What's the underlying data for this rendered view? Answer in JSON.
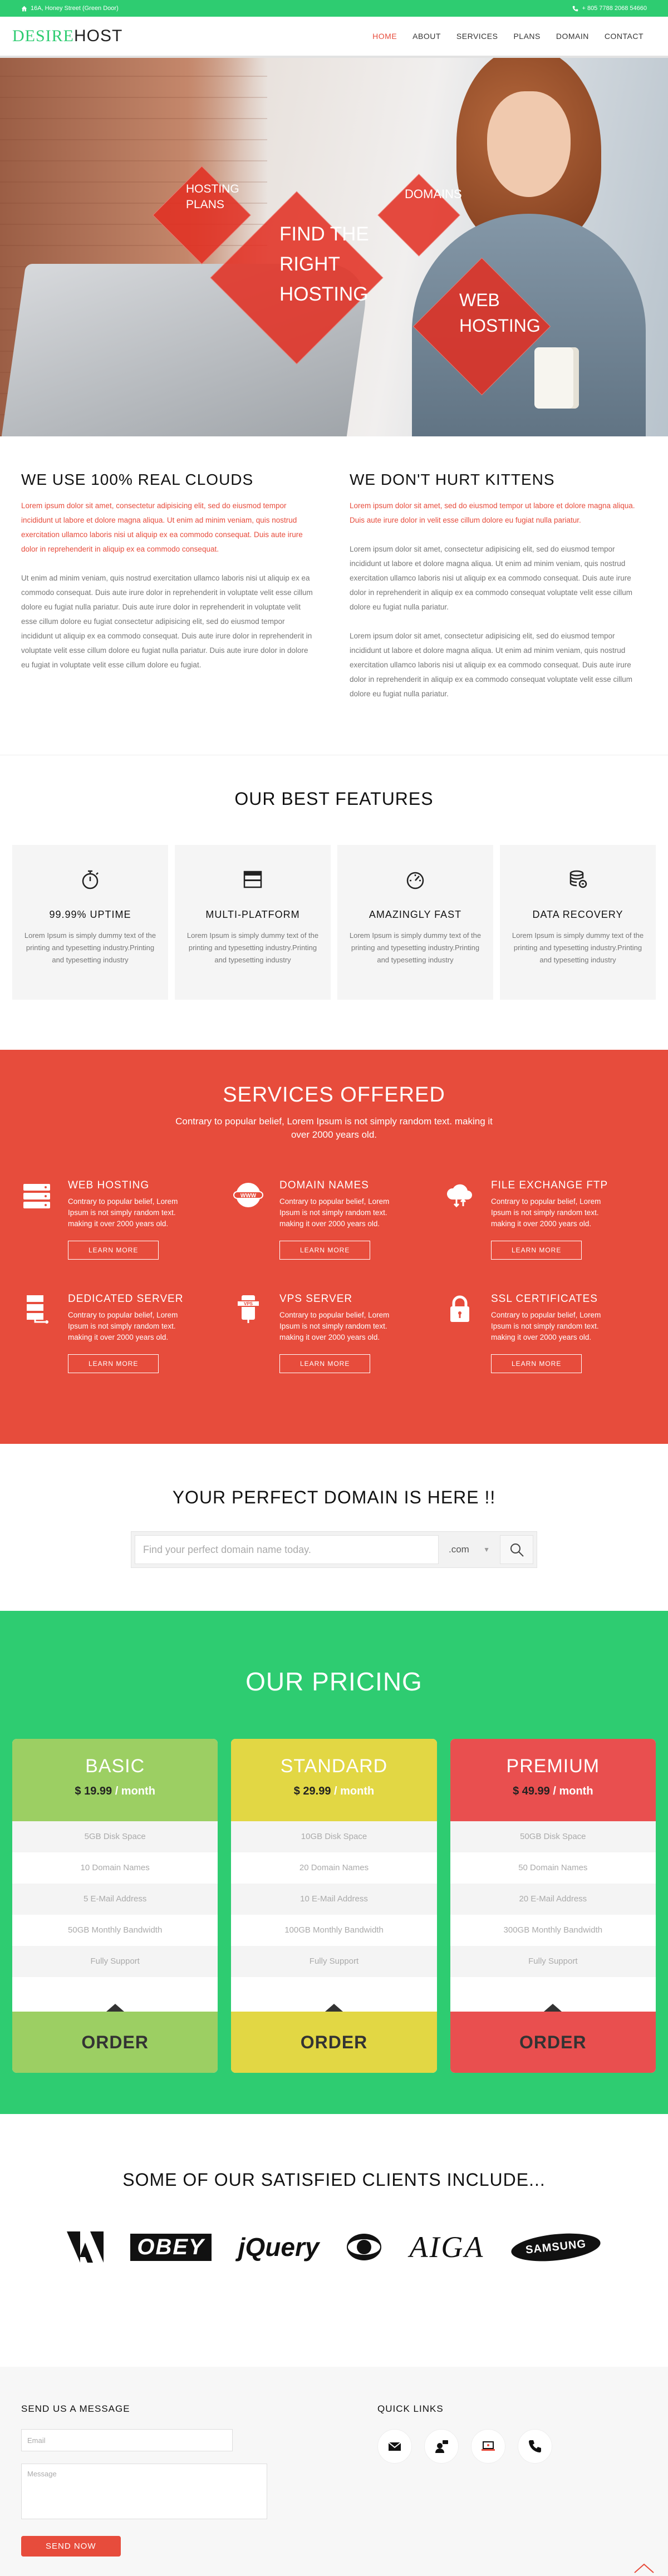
{
  "topbar": {
    "address": "16A, Honey Street (Green Door)",
    "phone": "+ 805 7788 2068 54660"
  },
  "nav": {
    "logo_a": "DESIRE",
    "logo_b": "HOST",
    "items": [
      "HOME",
      "ABOUT",
      "SERVICES",
      "PLANS",
      "DOMAIN",
      "CONTACT"
    ],
    "active": "HOME"
  },
  "hero": {
    "d1": "HOSTING PLANS",
    "d2": "FIND THE RIGHT HOSTING",
    "d3": "DOMAINS",
    "d4": "WEB HOSTING"
  },
  "intro": {
    "left": {
      "title": "WE USE 100% REAL CLOUDS",
      "red": "Lorem ipsum dolor sit amet, consectetur adipisicing elit, sed do eiusmod tempor incididunt ut labore et dolore magna aliqua. Ut enim ad minim veniam, quis nostrud exercitation ullamco laboris nisi ut aliquip ex ea commodo consequat. Duis aute irure dolor in reprehenderit in aliquip ex ea commodo consequat.",
      "gray": "Ut enim ad minim veniam, quis nostrud exercitation ullamco laboris nisi ut aliquip ex ea commodo consequat. Duis aute irure dolor in reprehenderit in voluptate velit esse cillum dolore eu fugiat nulla pariatur. Duis aute irure dolor in reprehenderit in voluptate velit esse cillum dolore eu fugiat consectetur adipisicing elit, sed do eiusmod tempor incididunt ut aliquip ex ea commodo consequat. Duis aute irure dolor in reprehenderit in voluptate velit esse cillum dolore eu fugiat nulla pariatur. Duis aute irure dolor in dolore eu fugiat in voluptate velit esse cillum dolore eu fugiat."
    },
    "right": {
      "title": "WE DON'T HURT KITTENS",
      "red": "Lorem ipsum dolor sit amet, sed do eiusmod tempor ut labore et dolore magna aliqua. Duis aute irure dolor in velit esse cillum dolore eu fugiat nulla pariatur.",
      "gray1": "Lorem ipsum dolor sit amet, consectetur adipisicing elit, sed do eiusmod tempor incididunt ut labore et dolore magna aliqua. Ut enim ad minim veniam, quis nostrud exercitation ullamco laboris nisi ut aliquip ex ea commodo consequat. Duis aute irure dolor in reprehenderit in aliquip ex ea commodo consequat voluptate velit esse cillum dolore eu fugiat nulla pariatur.",
      "gray2": "Lorem ipsum dolor sit amet, consectetur adipisicing elit, sed do eiusmod tempor incididunt ut labore et dolore magna aliqua. Ut enim ad minim veniam, quis nostrud exercitation ullamco laboris nisi ut aliquip ex ea commodo consequat. Duis aute irure dolor in reprehenderit in aliquip ex ea commodo consequat voluptate velit esse cillum dolore eu fugiat nulla pariatur."
    }
  },
  "features": {
    "title": "OUR BEST FEATURES",
    "items": [
      {
        "icon": "stopwatch-icon",
        "title": "99.99% UPTIME",
        "text": "Lorem Ipsum is simply dummy text of the printing and typesetting industry.Printing and typesetting industry"
      },
      {
        "icon": "browser-window-icon",
        "title": "MULTI-PLATFORM",
        "text": "Lorem Ipsum is simply dummy text of the printing and typesetting industry.Printing and typesetting industry"
      },
      {
        "icon": "speedometer-icon",
        "title": "AMAZINGLY FAST",
        "text": "Lorem Ipsum is simply dummy text of the printing and typesetting industry.Printing and typesetting industry"
      },
      {
        "icon": "database-icon",
        "title": "DATA RECOVERY",
        "text": "Lorem Ipsum is simply dummy text of the printing and typesetting industry.Printing and typesetting industry"
      }
    ]
  },
  "services": {
    "title": "SERVICES OFFERED",
    "subtitle": "Contrary to popular belief, Lorem Ipsum is not simply random text. making it over 2000 years old.",
    "items": [
      {
        "icon": "server-icon",
        "title": "WEB HOSTING",
        "text": "Contrary to popular belief, Lorem Ipsum is not simply random text. making it over 2000 years old.",
        "button": "LEARN MORE"
      },
      {
        "icon": "globe-www-icon",
        "title": "DOMAIN NAMES",
        "text": "Contrary to popular belief, Lorem Ipsum is not simply random text. making it over 2000 years old.",
        "button": "LEARN MORE"
      },
      {
        "icon": "cloud-transfer-icon",
        "title": "FILE EXCHANGE FTP",
        "text": "Contrary to popular belief, Lorem Ipsum is not simply random text. making it over 2000 years old.",
        "button": "LEARN MORE"
      },
      {
        "icon": "server-rack-icon",
        "title": "DEDICATED SERVER",
        "text": "Contrary to popular belief, Lorem Ipsum is not simply random text. making it over 2000 years old.",
        "button": "LEARN MORE"
      },
      {
        "icon": "vps-server-icon",
        "title": "VPS SERVER",
        "text": "Contrary to popular belief, Lorem Ipsum is not simply random text. making it over 2000 years old.",
        "button": "LEARN MORE"
      },
      {
        "icon": "lock-icon",
        "title": "SSL CERTIFICATES",
        "text": "Contrary to popular belief, Lorem Ipsum is not simply random text. making it over 2000 years old.",
        "button": "LEARN MORE"
      }
    ]
  },
  "domain": {
    "title": "YOUR PERFECT DOMAIN IS HERE !!",
    "placeholder": "Find your perfect domain name today.",
    "tld": ".com"
  },
  "pricing": {
    "title": "OUR PRICING",
    "plans": [
      {
        "name": "BASIC",
        "price": "$ 19.99",
        "period": " / month",
        "color": "#9ccf63",
        "features": [
          "5GB Disk Space",
          "10 Domain Names",
          "5 E-Mail Address",
          "50GB Monthly Bandwidth",
          "Fully Support"
        ],
        "button": "ORDER"
      },
      {
        "name": "STANDARD",
        "price": "$ 29.99",
        "period": " / month",
        "color": "#e2d744",
        "features": [
          "10GB Disk Space",
          "20 Domain Names",
          "10 E-Mail Address",
          "100GB Monthly Bandwidth",
          "Fully Support"
        ],
        "button": "ORDER"
      },
      {
        "name": "PREMIUM",
        "price": "$ 49.99",
        "period": " / month",
        "color": "#e94f4f",
        "features": [
          "50GB Disk Space",
          "50 Domain Names",
          "20 E-Mail Address",
          "300GB Monthly Bandwidth",
          "Fully Support"
        ],
        "button": "ORDER"
      }
    ]
  },
  "clients": {
    "title": "SOME OF OUR SATISFIED CLIENTS INCLUDE...",
    "logos": [
      "OBEY",
      "jQuery",
      "AIGA",
      "SAMSUNG"
    ]
  },
  "footer": {
    "message_title": "SEND US A MESSAGE",
    "email_placeholder": "Email",
    "message_placeholder": "Message",
    "send": "SEND NOW",
    "quick_title": "QUICK LINKS"
  },
  "colors": {
    "green": "#2ecc71",
    "red": "#e74c3c"
  }
}
